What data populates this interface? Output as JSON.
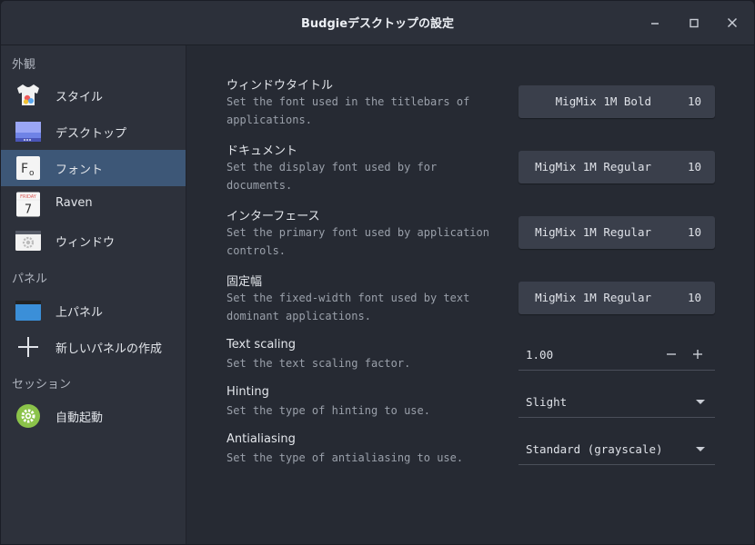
{
  "window": {
    "title": "Budgieデスクトップの設定"
  },
  "sidebar": {
    "sections": [
      {
        "label": "外観"
      },
      {
        "label": "パネル"
      },
      {
        "label": "セッション"
      }
    ],
    "items": [
      {
        "label": "スタイル",
        "icon": "tshirt-icon"
      },
      {
        "label": "デスクトップ",
        "icon": "desktop-icon"
      },
      {
        "label": "フォント",
        "icon": "font-icon",
        "selected": true
      },
      {
        "label": "Raven",
        "icon": "calendar-icon",
        "day_label": "FRIDAY",
        "day_number": "7"
      },
      {
        "label": "ウィンドウ",
        "icon": "window-gear-icon"
      },
      {
        "label": "上パネル",
        "icon": "panel-icon"
      },
      {
        "label": "新しいパネルの作成",
        "icon": "plus-icon"
      },
      {
        "label": "自動起動",
        "icon": "autostart-gear-icon"
      }
    ]
  },
  "settings": {
    "window_title_font": {
      "title": "ウィンドウタイトル",
      "description": "Set the font used in the titlebars of applications.",
      "font_name": "MigMix 1M Bold",
      "font_size": "10"
    },
    "document_font": {
      "title": "ドキュメント",
      "description": "Set the display font used by for documents.",
      "font_name": "MigMix 1M Regular",
      "font_size": "10"
    },
    "interface_font": {
      "title": "インターフェース",
      "description": "Set the primary font used by application controls.",
      "font_name": "MigMix 1M Regular",
      "font_size": "10"
    },
    "monospace_font": {
      "title": "固定幅",
      "description": "Set the fixed-width font used by text dominant applications.",
      "font_name": "MigMix 1M Regular",
      "font_size": "10"
    },
    "text_scaling": {
      "title": "Text scaling",
      "description": "Set the text scaling factor.",
      "value": "1.00"
    },
    "hinting": {
      "title": "Hinting",
      "description": "Set the type of hinting to use.",
      "selected": "Slight"
    },
    "antialiasing": {
      "title": "Antialiasing",
      "description": "Set the type of antialiasing to use.",
      "selected": "Standard (grayscale)"
    }
  },
  "colors": {
    "selected_row": "#3d5777",
    "sidebar_bg": "#2d313b",
    "content_bg": "#262a33",
    "button_bg": "#3a3f4b",
    "autostart_green": "#8bc34a"
  }
}
